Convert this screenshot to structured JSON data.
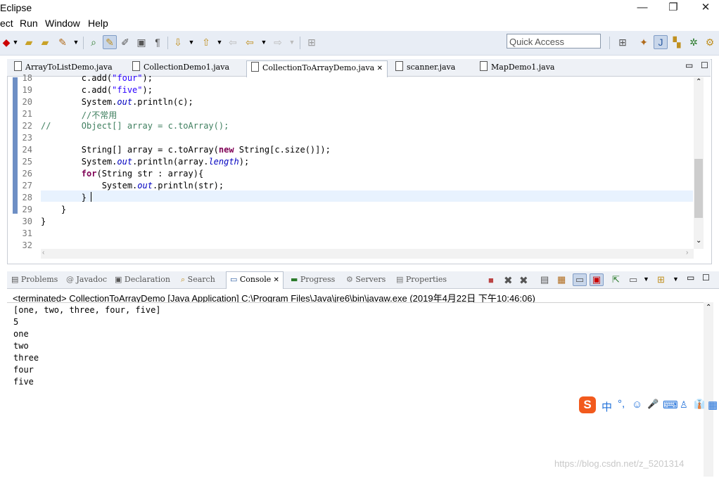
{
  "window": {
    "title": "Eclipse",
    "controls": [
      "—",
      "❐",
      "✕"
    ]
  },
  "menu": {
    "items": [
      "ect",
      "Run",
      "Window",
      "Help"
    ]
  },
  "toolbar": {
    "quick_access_placeholder": "Quick Access"
  },
  "editor": {
    "tabs": [
      {
        "label": "ArrayToListDemo.java",
        "active": false
      },
      {
        "label": "CollectionDemo1.java",
        "active": false
      },
      {
        "label": "CollectionToArrayDemo.java",
        "active": true,
        "close": "✕"
      },
      {
        "label": "scanner.java",
        "active": false
      },
      {
        "label": "MapDemo1.java",
        "active": false
      }
    ],
    "line_numbers": [
      "18",
      "19",
      "20",
      "21",
      "22",
      "23",
      "24",
      "25",
      "26",
      "27",
      "28",
      "29",
      "30",
      "31",
      "32"
    ],
    "lines": [
      "        c.add(\"four\");",
      "        c.add(\"five\");",
      "        System.out.println(c);",
      "        //不常用",
      "//      Object[] array = c.toArray();",
      "",
      "        String[] array = c.toArray(new String[c.size()]);",
      "        System.out.println(array.length);",
      "        for(String str : array){",
      "            System.out.println(str);",
      "        }",
      "    }",
      "}",
      "",
      ""
    ]
  },
  "console": {
    "tabs": [
      "Problems",
      "Javadoc",
      "Declaration",
      "Search",
      "Console",
      "Progress",
      "Servers",
      "Properties"
    ],
    "tab_icons": [
      "problems-icon",
      "javadoc-icon",
      "declaration-icon",
      "search-icon",
      "console-icon",
      "progress-icon",
      "servers-icon",
      "properties-icon"
    ],
    "active_tab": "Console",
    "terminated_line": "<terminated> CollectionToArrayDemo [Java Application] C:\\Program Files\\Java\\jre6\\bin\\javaw.exe (2019年4月22日 下午10:46:06)",
    "output": [
      "[one, two, three, four, five]",
      "5",
      "one",
      "two",
      "three",
      "four",
      "five"
    ]
  },
  "ime": {
    "logo": "S",
    "items": [
      "中",
      "°,",
      "☺",
      "🎤",
      "⌨",
      "👔",
      "▦"
    ]
  },
  "watermark": "https://blog.csdn.net/z_5201314"
}
